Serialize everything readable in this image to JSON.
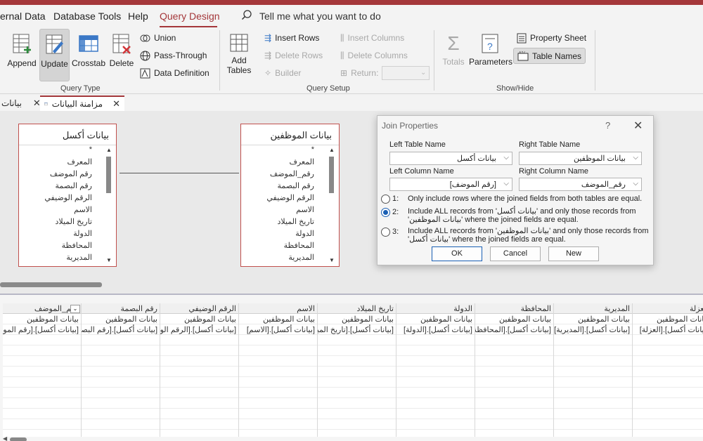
{
  "menu": {
    "tabs": [
      "ernal Data",
      "Database Tools",
      "Help",
      "Query Design"
    ],
    "active_tab": "Query Design",
    "tell_me": "Tell me what you want to do"
  },
  "ribbon": {
    "query_type": {
      "label": "Query Type",
      "append": "Append",
      "update": "Update",
      "crosstab": "Crosstab",
      "delete": "Delete",
      "union": "Union",
      "pass_through": "Pass-Through",
      "data_definition": "Data Definition"
    },
    "query_setup": {
      "label": "Query Setup",
      "add_tables_1": "Add",
      "add_tables_2": "Tables",
      "insert_rows": "Insert Rows",
      "delete_rows": "Delete Rows",
      "builder": "Builder",
      "insert_columns": "Insert Columns",
      "delete_columns": "Delete Columns",
      "return": "Return:"
    },
    "show_hide": {
      "label": "Show/Hide",
      "totals": "Totals",
      "parameters": "Parameters",
      "property_sheet": "Property Sheet",
      "table_names": "Table Names"
    }
  },
  "doc_tabs": {
    "left_partial": "بيانات",
    "active": "مزامنة البيانات"
  },
  "tables": {
    "left": {
      "title": "بيانات أكسل",
      "fields": [
        "*",
        "المعرف",
        "رقم الموضف",
        "رقم البصمة",
        "الرقم الوضيفي",
        "الاسم",
        "تاريخ الميلاد",
        "الدولة",
        "المحافظة",
        "المديرية"
      ]
    },
    "right": {
      "title": "بيانات الموظفين",
      "fields": [
        "*",
        "المعرف",
        "رقم_الموضف",
        "رقم البصمة",
        "الرقم الوضيفي",
        "الاسم",
        "تاريخ الميلاد",
        "الدولة",
        "المحافظة",
        "المديرية"
      ]
    }
  },
  "dialog": {
    "title": "Join Properties",
    "help": "?",
    "left_table_label": "Left Table Name",
    "right_table_label": "Right Table Name",
    "left_table_value": "بيانات أكسل",
    "right_table_value": "بيانات الموظفين",
    "left_column_label": "Left Column Name",
    "right_column_label": "Right Column Name",
    "left_column_value": "[رقم الموضف]",
    "right_column_value": "رقم_الموضف",
    "option1_num": "1:",
    "option1_text": "Only include rows where the joined fields from both tables are equal.",
    "option2_num": "2:",
    "option2_text": "Include ALL records from 'بيانات أكسل' and only those records from 'بيانات الموظفين' where the joined fields are equal.",
    "option3_num": "3:",
    "option3_text": "Include ALL records from 'بيانات الموظفين' and only those records from 'بيانات أكسل' where the joined fields are equal.",
    "selected_option": 2,
    "ok": "OK",
    "cancel": "Cancel",
    "new": "New"
  },
  "grid": {
    "columns": [
      {
        "field": "رقم_الموضف",
        "table": "بيانات الموظفين",
        "update": "[بيانات أكسل].[رقم الموضف]"
      },
      {
        "field": "رقم البصمة",
        "table": "بيانات الموظفين",
        "update": "[بيانات أكسل].[رقم البصمة]"
      },
      {
        "field": "الرقم الوضيفي",
        "table": "بيانات الموظفين",
        "update": "[بيانات أكسل].[الرقم الوضيفي]"
      },
      {
        "field": "الاسم",
        "table": "بيانات الموظفين",
        "update": "[بيانات أكسل].[الاسم]"
      },
      {
        "field": "تاريخ الميلاد",
        "table": "بيانات الموظفين",
        "update": "[بيانات أكسل].[تاريخ الميلاد]"
      },
      {
        "field": "الدولة",
        "table": "بيانات الموظفين",
        "update": "[بيانات أكسل].[الدولة]"
      },
      {
        "field": "المحافظة",
        "table": "بيانات الموظفين",
        "update": "[بيانات أكسل].[المحافظة]"
      },
      {
        "field": "المديرية",
        "table": "بيانات الموظفين",
        "update": "[بيانات أكسل].[المديرية]"
      },
      {
        "field": "العزلة",
        "table": "بيانات الموظفين",
        "update": "[بيانات أكسل].[العزلة]"
      }
    ]
  },
  "colors": {
    "accent": "#a4373a",
    "table_border": "#c0504d",
    "radio_selected": "#1a5fb4"
  }
}
